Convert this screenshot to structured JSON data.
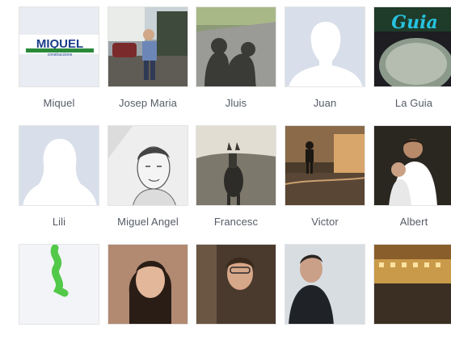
{
  "friends": [
    {
      "name": "Miquel",
      "logo_text": "MIQUEL",
      "logo_subtext": "construccions"
    },
    {
      "name": "Josep Maria"
    },
    {
      "name": "Jluis"
    },
    {
      "name": "Juan"
    },
    {
      "name": "La Guia",
      "logo_text": "Guia"
    },
    {
      "name": "Lili"
    },
    {
      "name": "Miguel Angel"
    },
    {
      "name": "Francesc"
    },
    {
      "name": "Victor"
    },
    {
      "name": "Albert"
    },
    {
      "name": ""
    },
    {
      "name": ""
    },
    {
      "name": ""
    },
    {
      "name": ""
    },
    {
      "name": ""
    }
  ],
  "colors": {
    "placeholder_bg": "#d8dfea",
    "name_text": "#555b66"
  }
}
